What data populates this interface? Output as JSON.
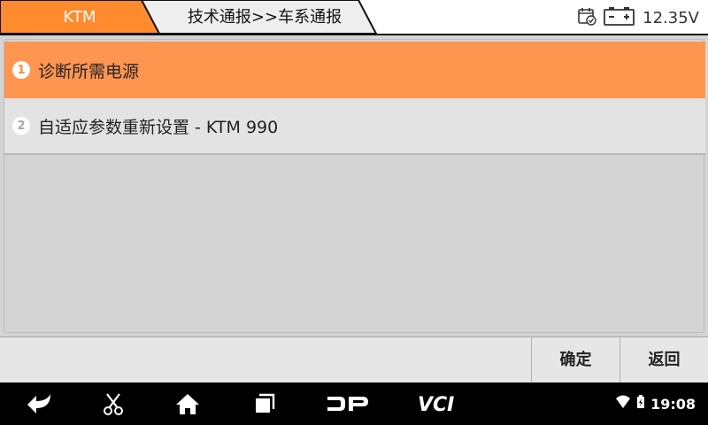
{
  "header": {
    "tab_brand": "KTM",
    "tab_path": "技术通报>>车系通报",
    "voltage": "12.35V",
    "icons": [
      "calendar-check-icon",
      "battery-icon"
    ]
  },
  "list": {
    "items": [
      {
        "number": "1",
        "label": "诊断所需电源",
        "selected": true
      },
      {
        "number": "2",
        "label": "自适应参数重新设置 - KTM 990",
        "selected": false
      }
    ]
  },
  "buttons": {
    "confirm": "确定",
    "back": "返回"
  },
  "navbar": {
    "clock": "19:08",
    "icons": [
      "back-icon",
      "scissors-icon",
      "home-icon",
      "recent-apps-icon",
      "dp-logo",
      "vci-logo",
      "wifi-icon",
      "battery-status-icon"
    ],
    "dp_text": "DP",
    "vci_text": "VCI"
  },
  "colors": {
    "accent": "#ff9650",
    "tab_orange": "#ff8b2e",
    "navbar": "#000000"
  }
}
